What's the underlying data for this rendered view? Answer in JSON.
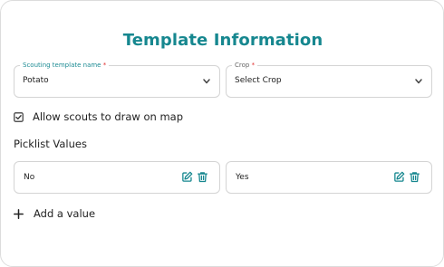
{
  "title": "Template Information",
  "template_name": {
    "label_text": "Scouting template name",
    "required_mark": "*",
    "value": "Potato"
  },
  "crop": {
    "label_text": "Crop",
    "required_mark": "*",
    "value": "Select Crop"
  },
  "allow_draw": {
    "label": "Allow scouts to draw on map",
    "checked": true
  },
  "picklist": {
    "heading": "Picklist Values",
    "items": [
      {
        "value": "No"
      },
      {
        "value": "Yes"
      }
    ]
  },
  "add_value": {
    "label": "Add a value"
  },
  "colors": {
    "accent": "#16878f",
    "label_accent": "#1c8b93",
    "required": "#e03131",
    "border": "#d4d4d4"
  },
  "icons": {
    "select_chevron": "chevron-down-icon",
    "checkbox": "checkbox-checked-icon",
    "edit": "edit-icon",
    "delete": "trash-icon",
    "add": "plus-icon"
  }
}
